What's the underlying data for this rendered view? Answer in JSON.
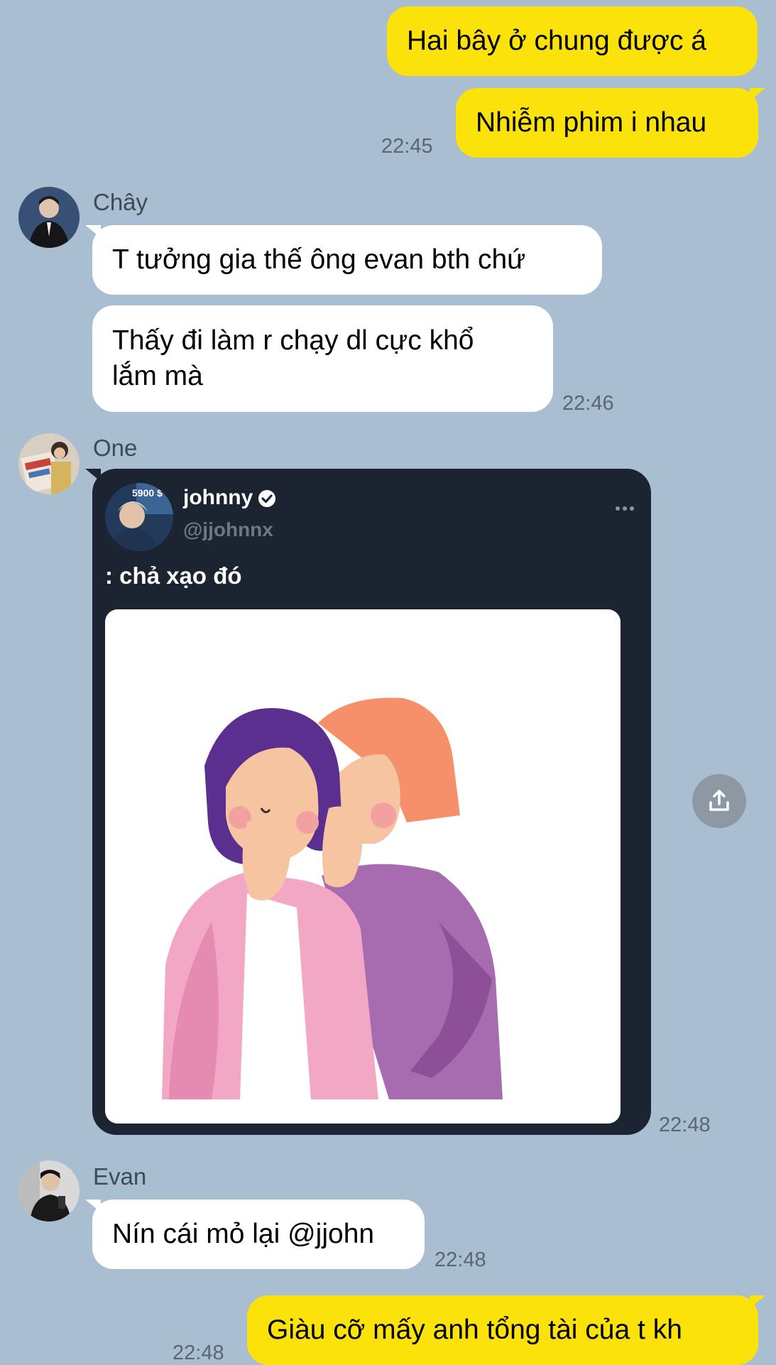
{
  "messages": {
    "m1": "Hai bây ở chung được á",
    "m2": "Nhiễm phim i nhau",
    "m2_time": "22:45",
    "chay_name": "Chây",
    "m3": "T tưởng gia thế ông evan bth chứ",
    "m4_line1": "Thấy đi làm r chạy dl cực khổ",
    "m4_line2": "lắm mà",
    "m4_time": "22:46",
    "one_name": "One",
    "card_time": "22:48",
    "evan_name": "Evan",
    "m5": "Nín cái mỏ lại @jjohn",
    "m5_time": "22:48",
    "m6": "Giàu cỡ mấy anh tổng tài của t kh",
    "m6_time": "22:48"
  },
  "tweet": {
    "display_name": "johnny",
    "handle": "@jjohnnx",
    "text": ": chả xạo đó",
    "avatar_overlay": "5900 $"
  },
  "icons": {
    "verified": "verified-badge-icon",
    "more": "more-dots-icon",
    "share": "share-upload-icon"
  },
  "colors": {
    "chat_background": "#a9bed1",
    "my_bubble": "#fbe20a",
    "their_bubble": "#ffffff",
    "tweet_card": "#1b2430"
  }
}
